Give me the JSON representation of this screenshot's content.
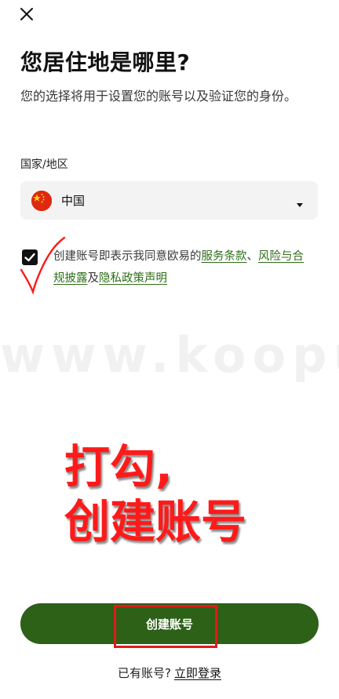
{
  "header": {
    "close_icon": "close-icon"
  },
  "page": {
    "title": "您居住地是哪里?",
    "subtitle": "您的选择将用于设置您的账号以及验证您的身份。"
  },
  "country": {
    "label": "国家/地区",
    "selected_value": "中国",
    "flag_icon": "china-flag-icon",
    "caret_icon": "caret-down-icon"
  },
  "consent": {
    "checked": true,
    "text_prefix": "创建账号即表示我同意欧易的",
    "link_terms": "服务条款",
    "separator": "、",
    "link_risk": "风险与合规披露",
    "conjunction": "及",
    "link_privacy": "隐私政策声明"
  },
  "watermark": {
    "text": "www.koopuu.com"
  },
  "annotation": {
    "line1": "打勾,",
    "line2": "创建账号",
    "color": "#ff1a1a"
  },
  "actions": {
    "create_button_label": "创建账号",
    "login_prompt": "已有账号?",
    "login_link": "立即登录",
    "button_color": "#2c6117",
    "link_color": "#2f6d18"
  }
}
